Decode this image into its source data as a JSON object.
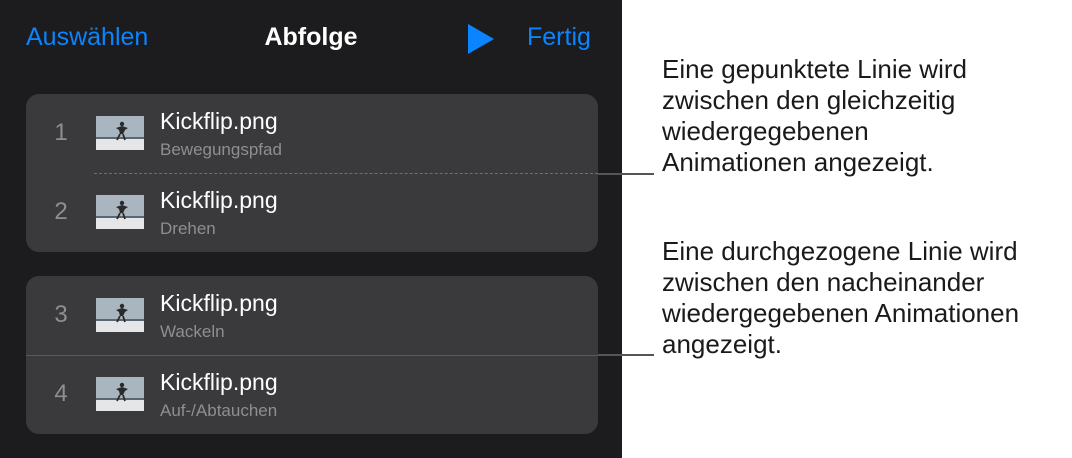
{
  "toolbar": {
    "select_label": "Auswählen",
    "title": "Abfolge",
    "play_icon": "play-icon",
    "done_label": "Fertig",
    "accent_color": "#0a84ff"
  },
  "builds": [
    {
      "number": "1",
      "name": "Kickflip.png",
      "effect": "Bewegungspfad"
    },
    {
      "number": "2",
      "name": "Kickflip.png",
      "effect": "Drehen"
    },
    {
      "number": "3",
      "name": "Kickflip.png",
      "effect": "Wackeln"
    },
    {
      "number": "4",
      "name": "Kickflip.png",
      "effect": "Auf-/Abtauchen"
    }
  ],
  "callouts": {
    "dotted": [
      "Eine gepunktete Linie wird",
      "zwischen den gleichzeitig",
      "wiedergegebenen",
      "Animationen angezeigt."
    ],
    "solid": [
      "Eine durchgezogene Linie wird",
      "zwischen den nacheinander",
      "wiedergegebenen Animationen",
      "angezeigt."
    ]
  }
}
